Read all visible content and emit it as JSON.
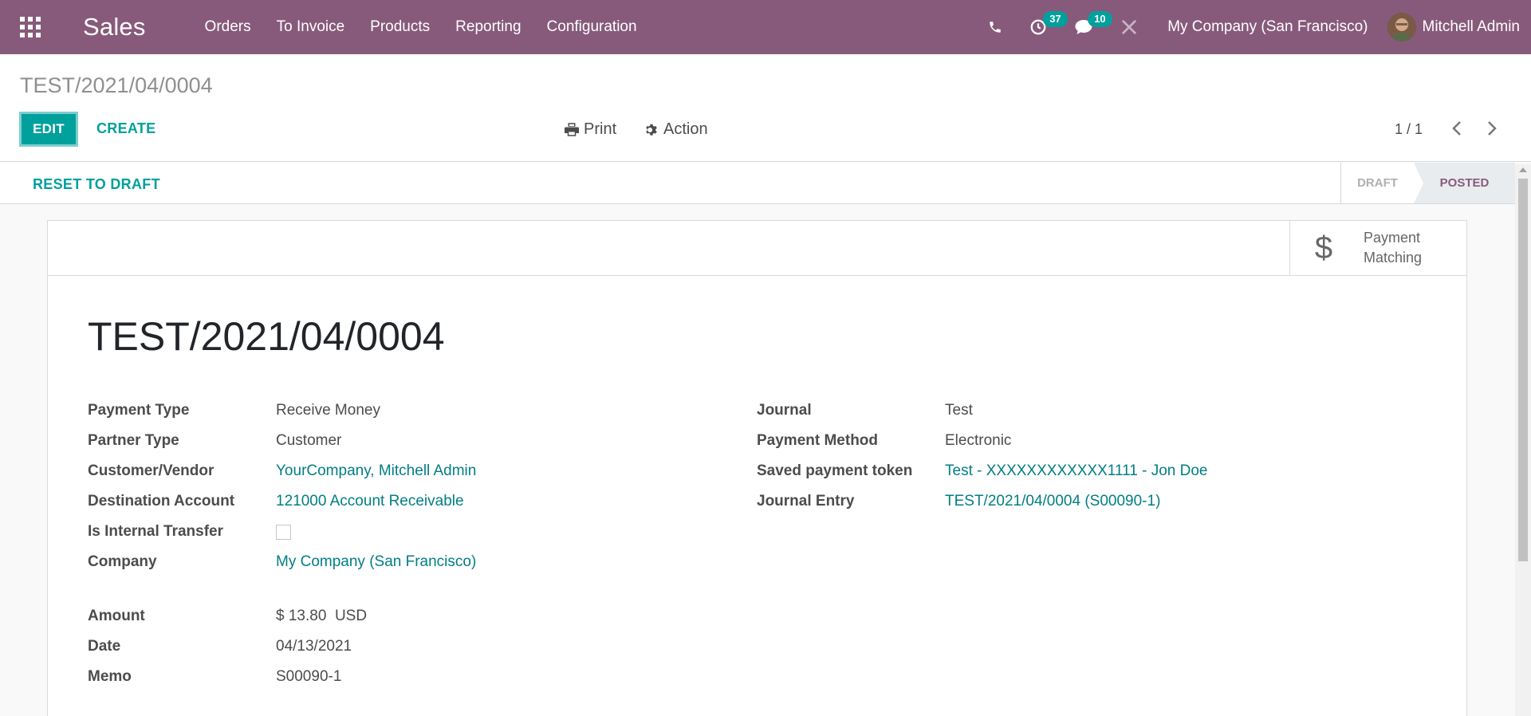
{
  "navbar": {
    "app_name": "Sales",
    "menu": [
      "Orders",
      "To Invoice",
      "Products",
      "Reporting",
      "Configuration"
    ],
    "activity_count": "37",
    "message_count": "10",
    "company": "My Company (San Francisco)",
    "user": "Mitchell Admin"
  },
  "control_panel": {
    "breadcrumb": "TEST/2021/04/0004",
    "edit_label": "EDIT",
    "create_label": "CREATE",
    "print_label": "Print",
    "action_label": "Action",
    "pager": "1 / 1"
  },
  "statusbar": {
    "reset_label": "RESET TO DRAFT",
    "stages": [
      "DRAFT",
      "POSTED"
    ],
    "active_stage": "POSTED"
  },
  "smart_button": {
    "line1": "Payment",
    "line2": "Matching"
  },
  "record": {
    "title": "TEST/2021/04/0004",
    "left_fields": [
      {
        "label": "Payment Type",
        "value": "Receive Money"
      },
      {
        "label": "Partner Type",
        "value": "Customer"
      },
      {
        "label": "Customer/Vendor",
        "value": "YourCompany, Mitchell Admin"
      },
      {
        "label": "Destination Account",
        "value": "121000 Account Receivable"
      },
      {
        "label": "Is Internal Transfer",
        "value": ""
      },
      {
        "label": "Company",
        "value": "My Company (San Francisco)"
      }
    ],
    "amount_fields": [
      {
        "label": "Amount",
        "value": "$ 13.80  USD"
      },
      {
        "label": "Date",
        "value": "04/13/2021"
      },
      {
        "label": "Memo",
        "value": "S00090-1"
      }
    ],
    "right_fields": [
      {
        "label": "Journal",
        "value": "Test"
      },
      {
        "label": "Payment Method",
        "value": "Electronic"
      },
      {
        "label": "Saved payment token",
        "value": "Test - XXXXXXXXXXXX1111 - Jon Doe"
      },
      {
        "label": "Journal Entry",
        "value": "TEST/2021/04/0004 (S00090-1)"
      }
    ]
  },
  "colors": {
    "navbar": "#875a7b",
    "accent": "#00a09d",
    "link": "#017e84"
  }
}
